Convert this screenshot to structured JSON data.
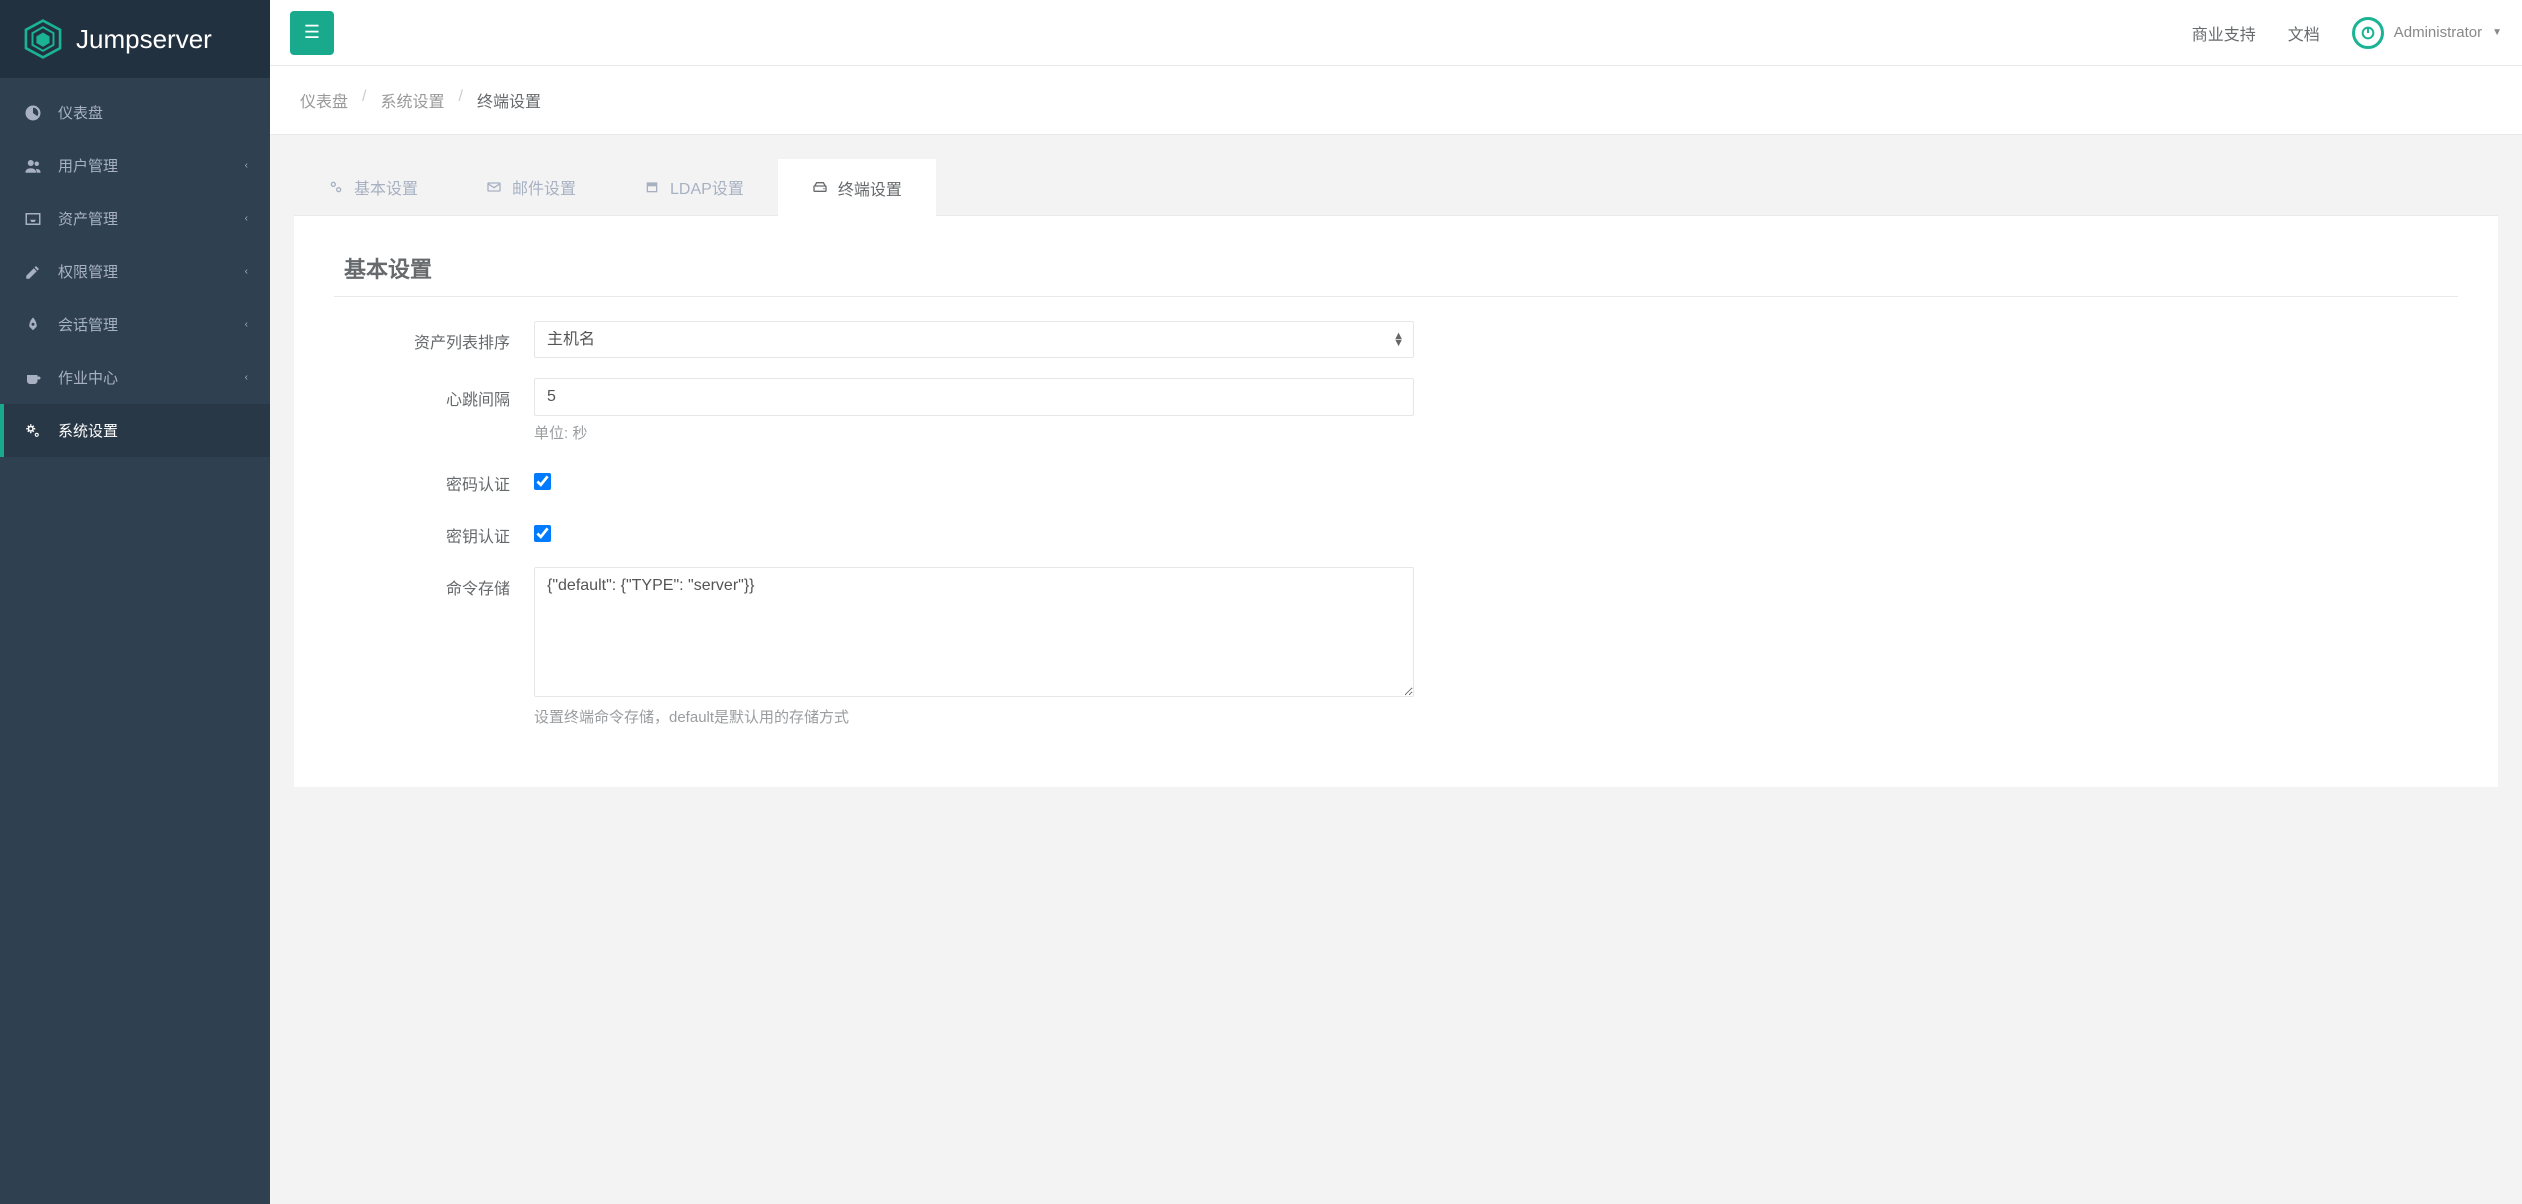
{
  "brand": "Jumpserver",
  "sidebar": {
    "items": [
      {
        "label": "仪表盘",
        "expandable": false
      },
      {
        "label": "用户管理",
        "expandable": true
      },
      {
        "label": "资产管理",
        "expandable": true
      },
      {
        "label": "权限管理",
        "expandable": true
      },
      {
        "label": "会话管理",
        "expandable": true
      },
      {
        "label": "作业中心",
        "expandable": true
      },
      {
        "label": "系统设置",
        "expandable": false
      }
    ]
  },
  "topbar": {
    "links": [
      "商业支持",
      "文档"
    ],
    "user": "Administrator"
  },
  "breadcrumb": [
    "仪表盘",
    "系统设置",
    "终端设置"
  ],
  "tabs": [
    {
      "label": "基本设置"
    },
    {
      "label": "邮件设置"
    },
    {
      "label": "LDAP设置"
    },
    {
      "label": "终端设置"
    }
  ],
  "form": {
    "section_title": "基本设置",
    "asset_sort": {
      "label": "资产列表排序",
      "value": "主机名"
    },
    "heartbeat": {
      "label": "心跳间隔",
      "value": "5",
      "help": "单位: 秒"
    },
    "password_auth": {
      "label": "密码认证",
      "checked": true
    },
    "key_auth": {
      "label": "密钥认证",
      "checked": true
    },
    "command_store": {
      "label": "命令存储",
      "value": "{\"default\": {\"TYPE\": \"server\"}}",
      "help": "设置终端命令存储，default是默认用的存储方式"
    }
  }
}
